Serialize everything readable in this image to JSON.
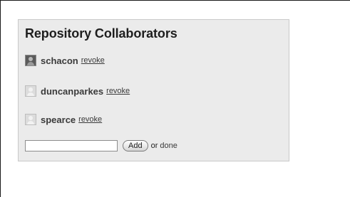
{
  "panel": {
    "title": "Repository Collaborators"
  },
  "collaborators": [
    {
      "username": "schacon",
      "action": "revoke",
      "avatar_icon": "user-photo-icon"
    },
    {
      "username": "duncanparkes",
      "action": "revoke",
      "avatar_icon": "default-avatar-icon"
    },
    {
      "username": "spearce",
      "action": "revoke",
      "avatar_icon": "default-avatar-icon"
    }
  ],
  "add_form": {
    "input_value": "",
    "button_label": "Add",
    "or_text": "or",
    "done_label": "done"
  }
}
